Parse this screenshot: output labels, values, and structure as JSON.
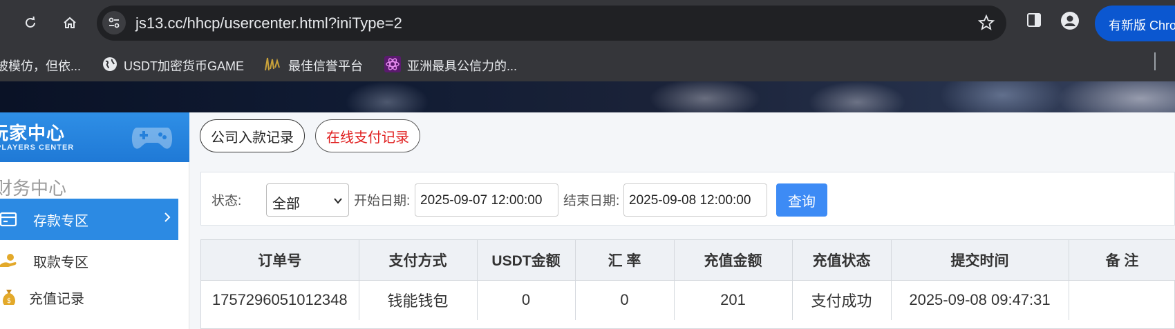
{
  "browser": {
    "url_host": "js13.cc",
    "url_path": "/hhcp/usercenter.html?iniType=2",
    "update_label": "有新版 Chrome",
    "bookmarks": [
      {
        "label": "被模仿，但依..."
      },
      {
        "label": "USDT加密货币GAME"
      },
      {
        "label": "最佳信誉平台"
      },
      {
        "label": "亚洲最具公信力的..."
      }
    ]
  },
  "sidebar": {
    "title": "玩家中心",
    "subtitle": "PLAYERS CENTER",
    "section": "财务中心",
    "items": [
      {
        "label": "存款专区",
        "active": true,
        "icon": "card-icon"
      },
      {
        "label": "取款专区",
        "active": false,
        "icon": "hand-coin-icon"
      },
      {
        "label": "充值记录",
        "active": false,
        "icon": "money-bag-icon"
      }
    ]
  },
  "tabs": [
    {
      "label": "公司入款记录",
      "active": false
    },
    {
      "label": "在线支付记录",
      "active": true
    }
  ],
  "filter": {
    "status_label": "状态:",
    "status_value": "全部",
    "start_label": "开始日期:",
    "start_value": "2025-09-07 12:00:00",
    "end_label": "结束日期:",
    "end_value": "2025-09-08 12:00:00",
    "query_label": "查询"
  },
  "table": {
    "headers": [
      "订单号",
      "支付方式",
      "USDT金额",
      "汇 率",
      "充值金额",
      "充值状态",
      "提交时间",
      "备 注"
    ],
    "rows": [
      [
        "1757296051012348",
        "钱能钱包",
        "0",
        "0",
        "201",
        "支付成功",
        "2025-09-08 09:47:31",
        ""
      ]
    ]
  },
  "colors": {
    "accent": "#2c8ae3",
    "query_button": "#3d8bf5",
    "active_tab_text": "#e02020",
    "chrome_bg": "#35363a"
  }
}
